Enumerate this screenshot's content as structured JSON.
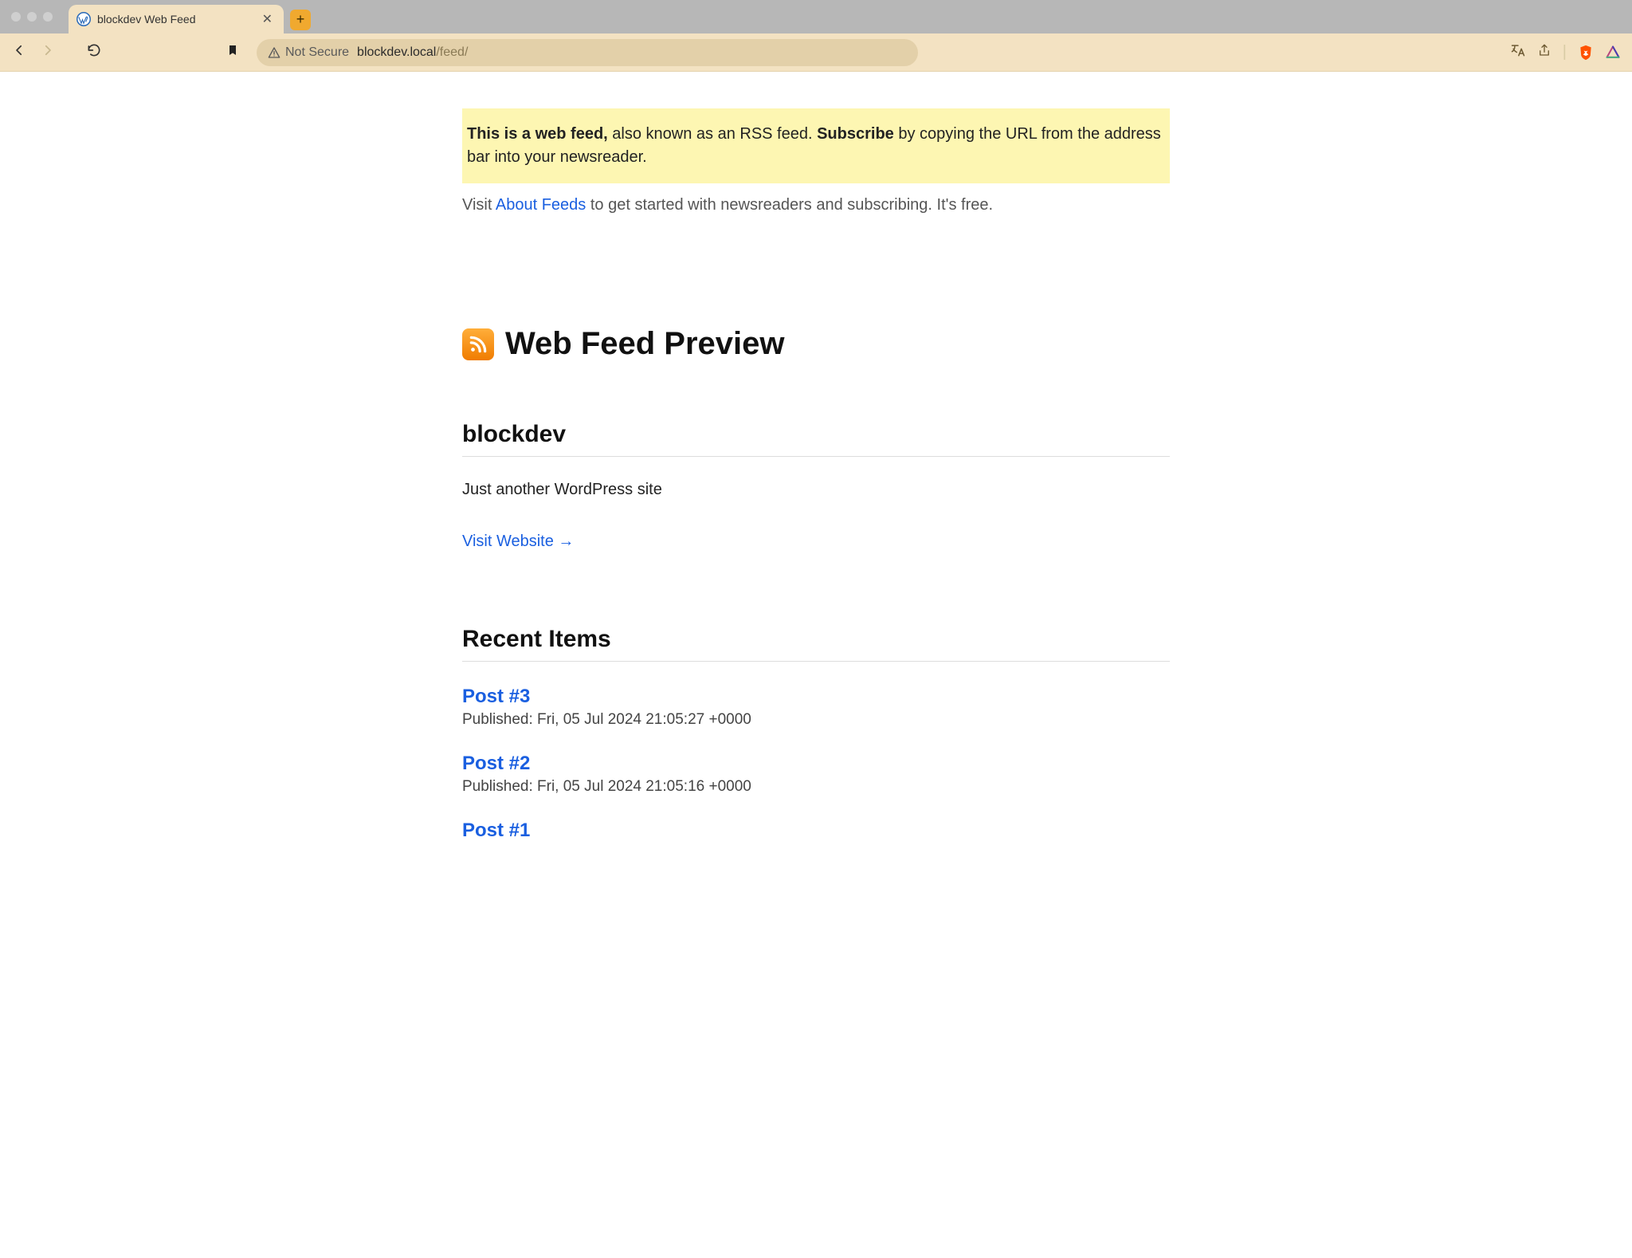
{
  "browser": {
    "tab_title": "blockdev Web Feed",
    "not_secure_label": "Not Secure",
    "url_host": "blockdev.local",
    "url_path": "/feed/"
  },
  "notice": {
    "lead_strong": "This is a web feed,",
    "mid_text": " also known as an RSS feed. ",
    "subscribe_strong": "Subscribe",
    "tail_text": " by copying the URL from the address bar into your newsreader."
  },
  "about": {
    "prefix": "Visit ",
    "link_text": "About Feeds",
    "suffix": " to get started with newsreaders and subscribing. It's free."
  },
  "feed": {
    "preview_heading": "Web Feed Preview",
    "site_title": "blockdev",
    "tagline": "Just another WordPress site",
    "visit_link_text": "Visit Website →",
    "recent_heading": "Recent Items"
  },
  "items": [
    {
      "title": "Post #3",
      "published": "Published: Fri, 05 Jul 2024 21:05:27 +0000"
    },
    {
      "title": "Post #2",
      "published": "Published: Fri, 05 Jul 2024 21:05:16 +0000"
    },
    {
      "title": "Post #1",
      "published": ""
    }
  ]
}
